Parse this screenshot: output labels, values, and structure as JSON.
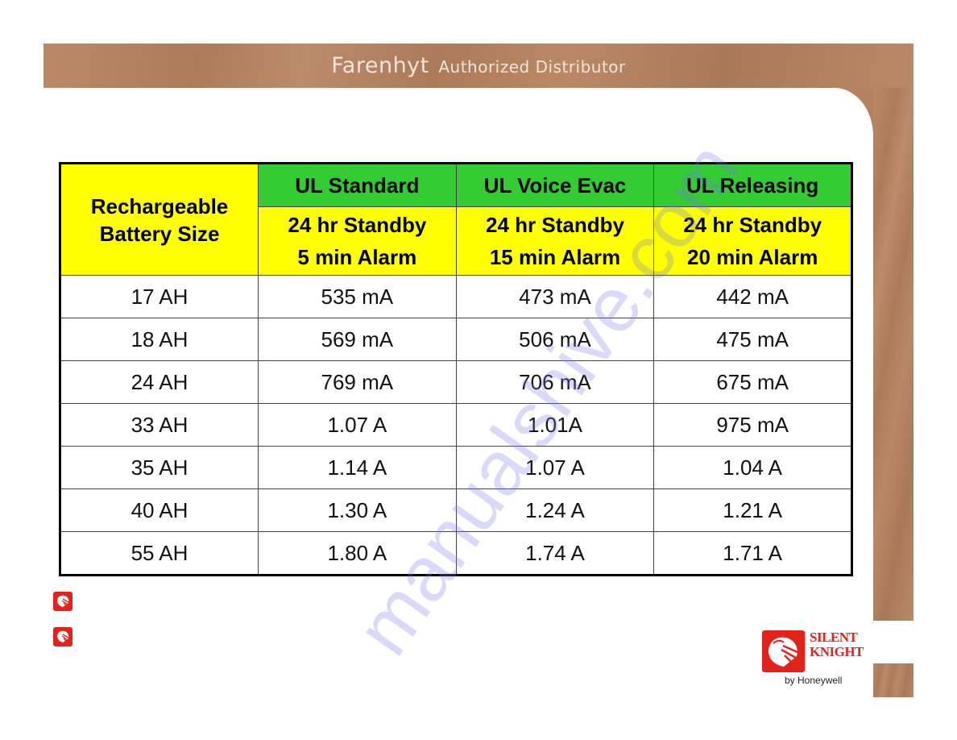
{
  "header": {
    "brand": "Farenhyt",
    "subtitle": "Authorized Distributor"
  },
  "table": {
    "size_header": "Rechargeable Battery Size",
    "columns": [
      {
        "title": "UL Standard",
        "standby": "24 hr Standby",
        "alarm": "5 min Alarm"
      },
      {
        "title": "UL Voice Evac",
        "standby": "24 hr Standby",
        "alarm": "15 min Alarm"
      },
      {
        "title": "UL Releasing",
        "standby": "24 hr Standby",
        "alarm": "20 min Alarm"
      }
    ],
    "rows": [
      {
        "size": "17 AH",
        "values": [
          "535 mA",
          "473 mA",
          "442 mA"
        ]
      },
      {
        "size": "18 AH",
        "values": [
          "569 mA",
          "506 mA",
          "475 mA"
        ]
      },
      {
        "size": "24 AH",
        "values": [
          "769 mA",
          "706 mA",
          "675 mA"
        ]
      },
      {
        "size": "33 AH",
        "values": [
          "1.07 A",
          "1.01A",
          "975 mA"
        ]
      },
      {
        "size": "35 AH",
        "values": [
          "1.14 A",
          "1.07 A",
          "1.04 A"
        ]
      },
      {
        "size": "40 AH",
        "values": [
          "1.30 A",
          "1.24 A",
          "1.21 A"
        ]
      },
      {
        "size": "55 AH",
        "values": [
          "1.80 A",
          "1.74 A",
          "1.71 A"
        ]
      }
    ]
  },
  "bullets": [
    {
      "icon": "knight-helmet-icon"
    },
    {
      "icon": "knight-helmet-icon"
    }
  ],
  "logo": {
    "line1": "SILENT",
    "line2": "KNIGHT",
    "sub": "by Honeywell",
    "color": "#e3221c"
  },
  "colors": {
    "header_green": "#33cc33",
    "header_yellow": "#ffff00",
    "wood": "#b5825f"
  },
  "watermark": "manualshive.com"
}
